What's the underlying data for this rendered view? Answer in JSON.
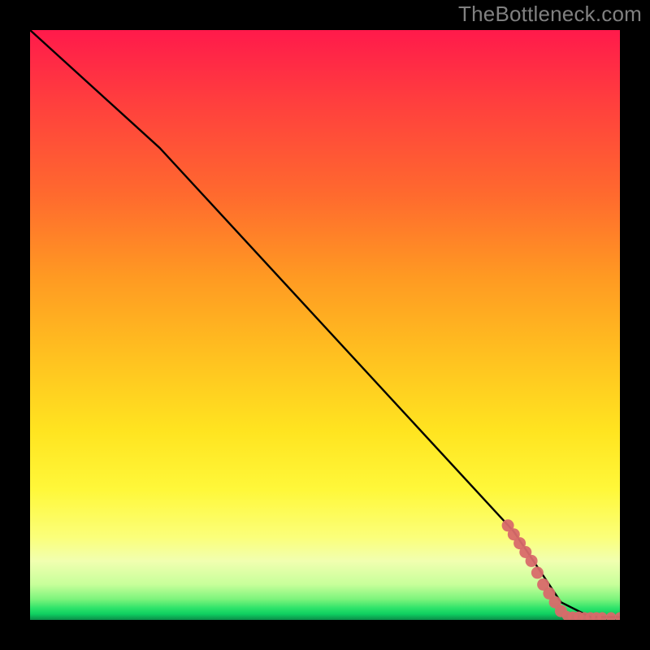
{
  "watermark": "TheBottleneck.com",
  "gradient_colors": {
    "top": "#ff1a4b",
    "mid_upper": "#ff9a22",
    "mid": "#ffe420",
    "mid_lower": "#fbff7a",
    "bottom": "#0b8c48"
  },
  "line_color": "#000000",
  "point_color": "#d86a6a",
  "chart_data": {
    "type": "line",
    "title": "",
    "xlabel": "",
    "ylabel": "",
    "xlim": [
      0,
      100
    ],
    "ylim": [
      0,
      100
    ],
    "line": [
      {
        "x": 0,
        "y": 100.0
      },
      {
        "x": 22,
        "y": 80.0
      },
      {
        "x": 82,
        "y": 15.0
      },
      {
        "x": 90,
        "y": 3.0
      },
      {
        "x": 95,
        "y": 0.5
      },
      {
        "x": 100,
        "y": 0.5
      }
    ],
    "points": [
      {
        "x": 81.0,
        "y": 16.0
      },
      {
        "x": 82.0,
        "y": 14.5
      },
      {
        "x": 83.0,
        "y": 13.0
      },
      {
        "x": 84.0,
        "y": 11.5
      },
      {
        "x": 85.0,
        "y": 10.0
      },
      {
        "x": 86.0,
        "y": 8.0
      },
      {
        "x": 87.0,
        "y": 6.0
      },
      {
        "x": 88.0,
        "y": 4.5
      },
      {
        "x": 89.0,
        "y": 3.0
      },
      {
        "x": 90.0,
        "y": 1.5
      },
      {
        "x": 91.0,
        "y": 0.7
      },
      {
        "x": 92.0,
        "y": 0.6
      },
      {
        "x": 93.0,
        "y": 0.6
      },
      {
        "x": 94.0,
        "y": 0.5
      },
      {
        "x": 95.0,
        "y": 0.5
      },
      {
        "x": 96.0,
        "y": 0.5
      },
      {
        "x": 97.0,
        "y": 0.5
      },
      {
        "x": 98.5,
        "y": 0.5
      },
      {
        "x": 100.0,
        "y": 0.5
      }
    ]
  }
}
